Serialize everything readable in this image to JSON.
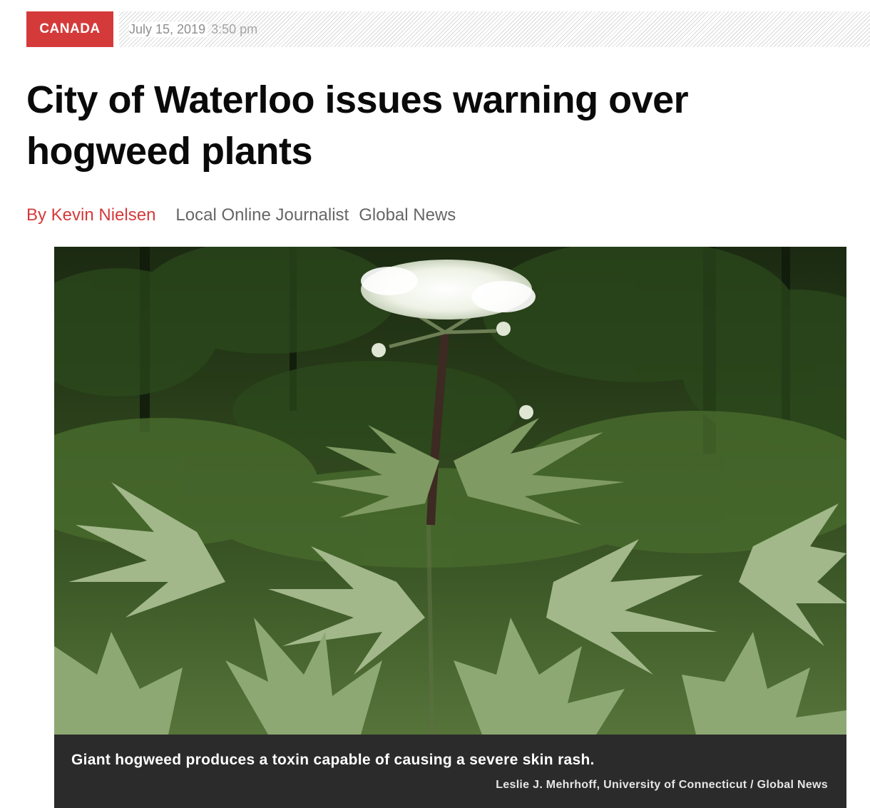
{
  "article": {
    "category": "CANADA",
    "date": "July 15, 2019",
    "time": "3:50 pm",
    "headline": "City of Waterloo issues warning over hogweed plants",
    "byline": {
      "author": "By Kevin Nielsen",
      "role": "Local Online Journalist",
      "outlet": "Global News"
    }
  },
  "figure": {
    "caption": "Giant hogweed produces a toxin capable of causing a severe skin rash.",
    "credit": "Leslie J. Mehrhoff, University of Connecticut / Global News"
  },
  "colors": {
    "accent": "#d53a3a",
    "caption_bg": "#2b2b2b",
    "meta_text": "#666666"
  }
}
